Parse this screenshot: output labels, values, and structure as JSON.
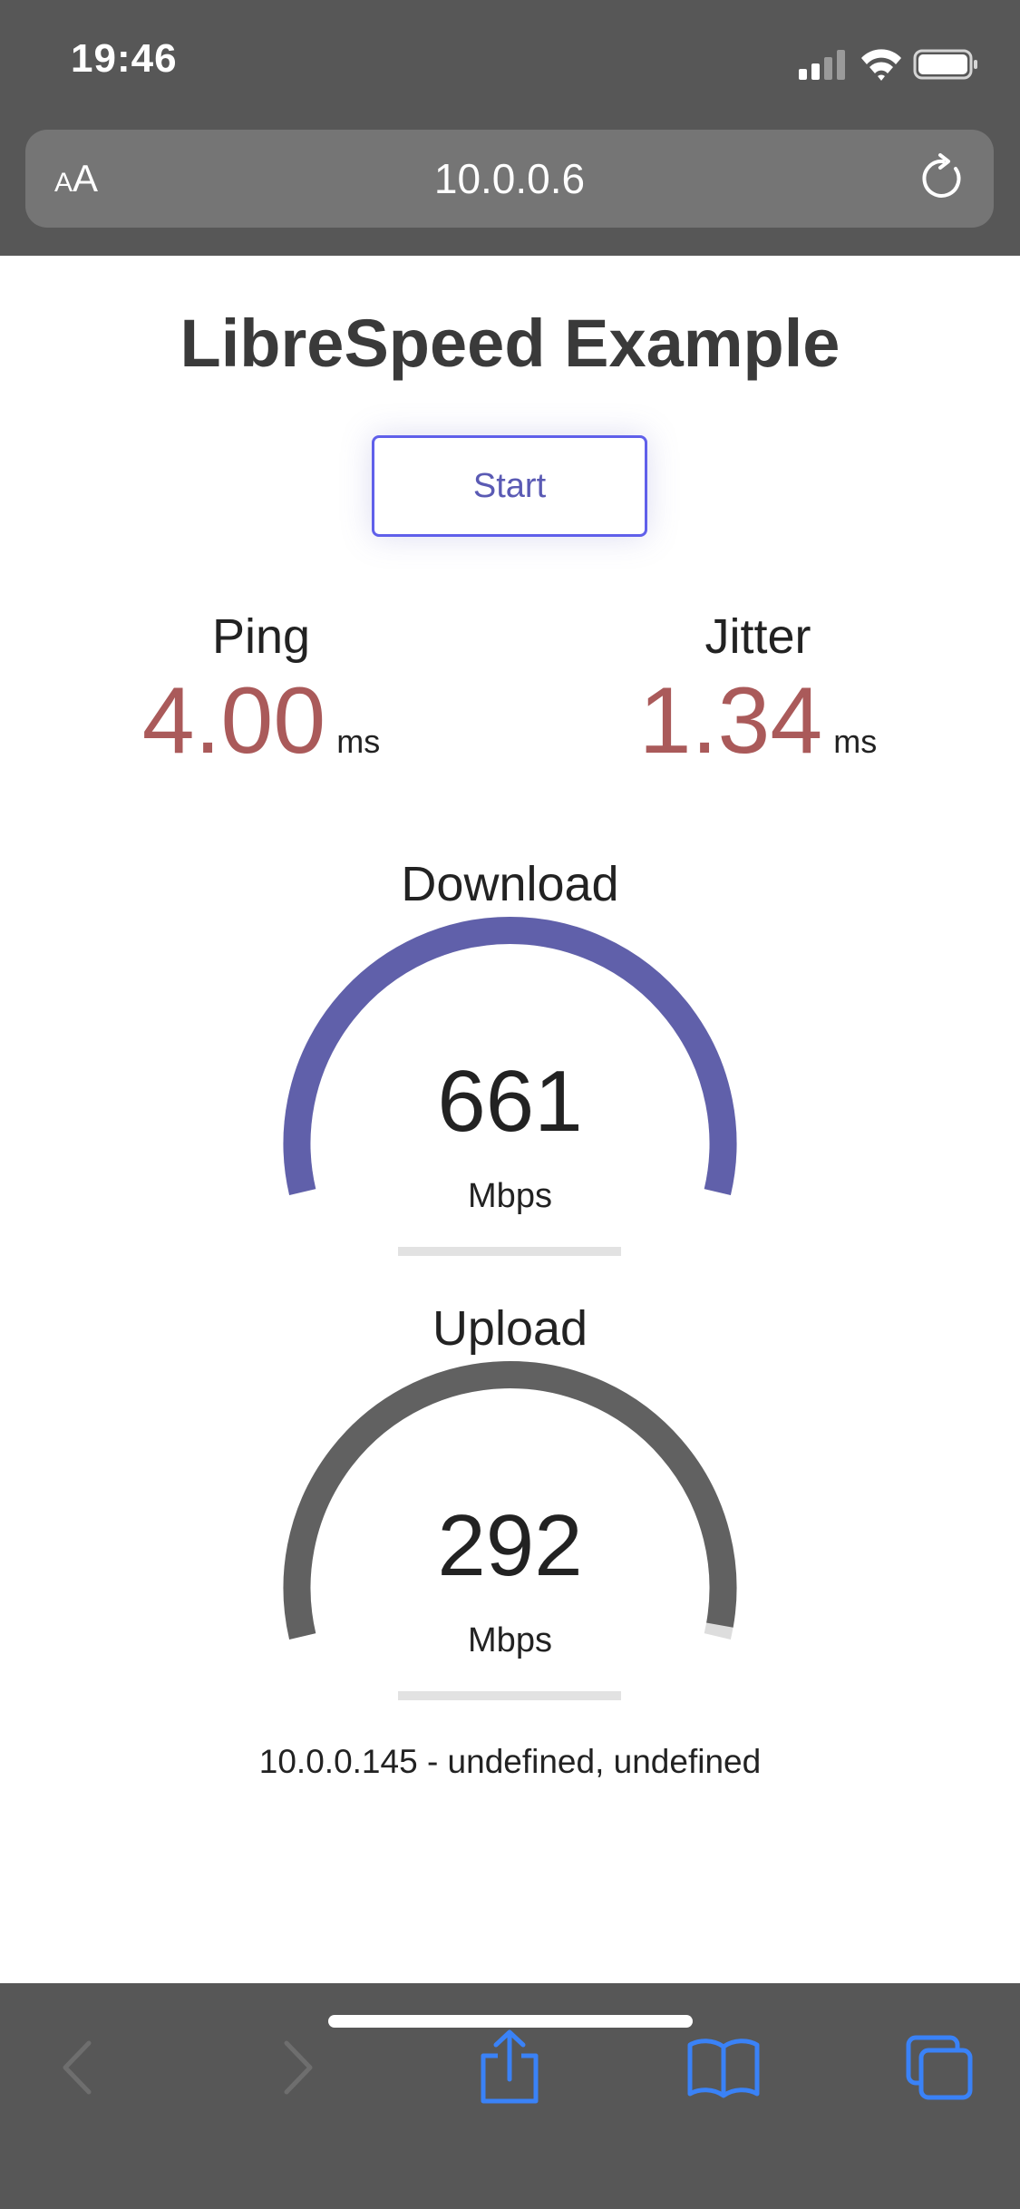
{
  "status_bar": {
    "time": "19:46"
  },
  "browser": {
    "text_size_small": "A",
    "text_size_large": "A",
    "url": "10.0.0.6"
  },
  "page": {
    "title": "LibreSpeed Example",
    "start_label": "Start",
    "ping": {
      "label": "Ping",
      "value": "4.00",
      "unit": "ms"
    },
    "jitter": {
      "label": "Jitter",
      "value": "1.34",
      "unit": "ms"
    },
    "download": {
      "label": "Download",
      "value": "661",
      "unit": "Mbps",
      "gauge_fraction": 1.0,
      "progress": 0,
      "color": "#6060aa"
    },
    "upload": {
      "label": "Upload",
      "value": "292",
      "unit": "Mbps",
      "gauge_fraction": 0.985,
      "progress": 0,
      "color": "#616161"
    },
    "gauge_track_color": "#dddddd",
    "ip_info": "10.0.0.145 - undefined, undefined"
  },
  "colors": {
    "chrome": "#575757",
    "accent_blue": "#3a82f7",
    "value_red": "#aa5a5a"
  },
  "toolbar": {
    "back_icon": "chevron-left-icon",
    "forward_icon": "chevron-right-icon",
    "share_icon": "share-icon",
    "bookmarks_icon": "book-icon",
    "tabs_icon": "tabs-icon"
  }
}
